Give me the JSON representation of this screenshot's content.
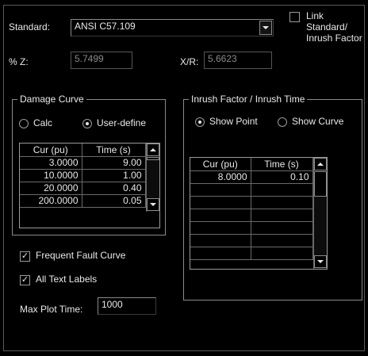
{
  "standard": {
    "label": "Standard:",
    "value": "ANSI C57.109"
  },
  "link_checkbox": {
    "label_line1": "Link",
    "label_line2": "Standard/",
    "label_line3": "Inrush Factor",
    "checked": false
  },
  "pct_z": {
    "label": "% Z:",
    "value": "5.7499"
  },
  "x_r": {
    "label": "X/R:",
    "value": "5.6623"
  },
  "damage_curve": {
    "title": "Damage Curve",
    "radio_calc": "Calc",
    "radio_user": "User-define",
    "selected": "User-define",
    "columns": [
      "Cur (pu)",
      "Time (s)"
    ],
    "rows": [
      [
        "3.0000",
        "9.00"
      ],
      [
        "10.0000",
        "1.00"
      ],
      [
        "20.0000",
        "0.40"
      ],
      [
        "200.0000",
        "0.05"
      ]
    ]
  },
  "inrush": {
    "title": "Inrush Factor / Inrush Time",
    "radio_point": "Show Point",
    "radio_curve": "Show Curve",
    "selected": "Show Point",
    "columns": [
      "Cur (pu)",
      "Time (s)"
    ],
    "rows": [
      [
        "8.0000",
        "0.10"
      ]
    ]
  },
  "frequent_fault": {
    "label": "Frequent Fault Curve",
    "checked": true
  },
  "all_text_labels": {
    "label": "All Text Labels",
    "checked": true
  },
  "max_plot_time": {
    "label": "Max Plot Time:",
    "value": "1000"
  },
  "icons": {
    "check": "checkmark-icon",
    "dropdown": "chevron-down-icon",
    "scroll_up": "scroll-up-icon",
    "scroll_down": "scroll-down-icon"
  }
}
